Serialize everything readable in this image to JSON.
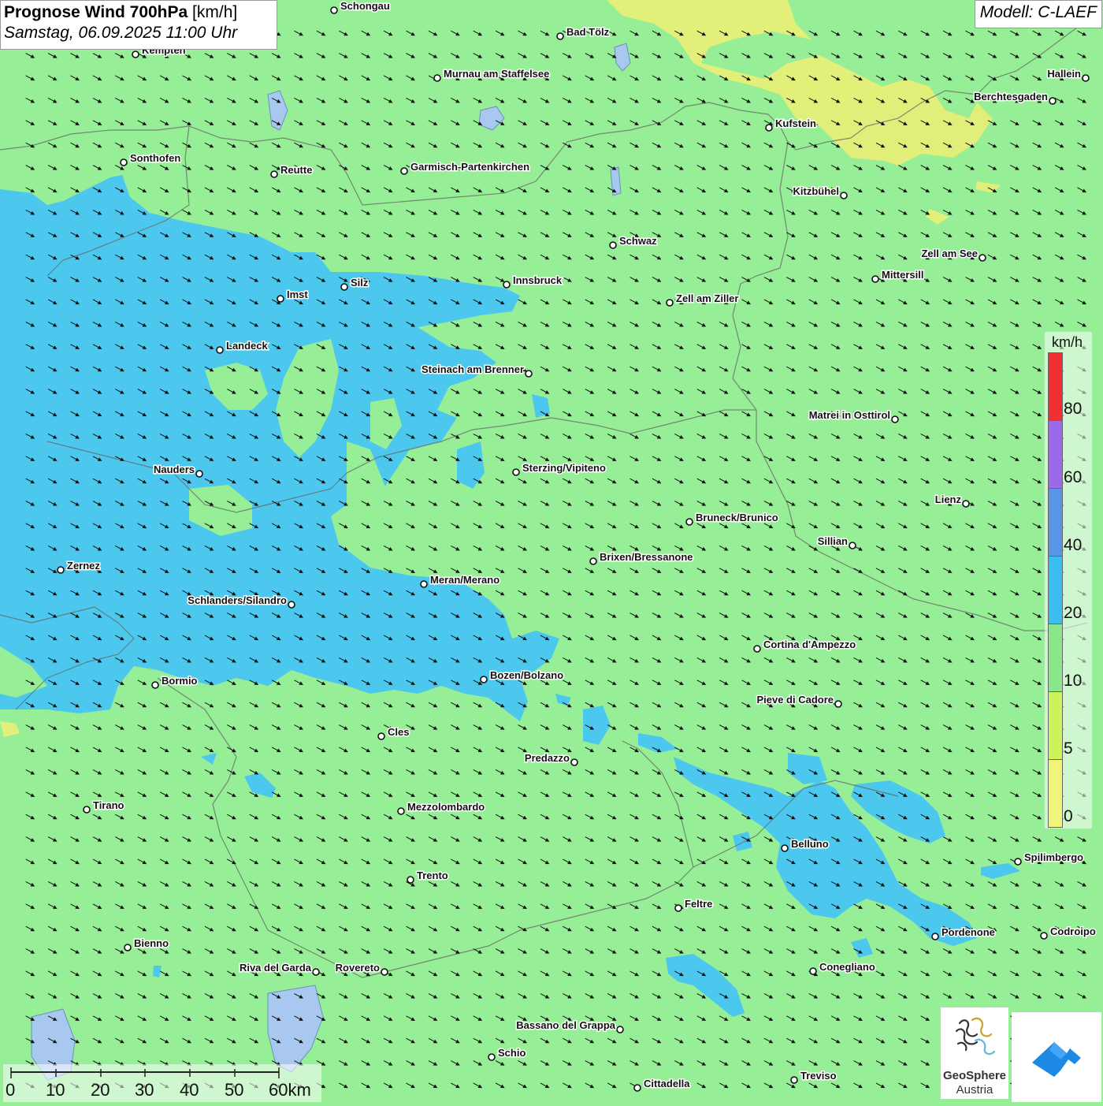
{
  "header": {
    "title_bold": "Prognose Wind 700hPa",
    "title_unit": " [km/h]",
    "datetime": "Samstag, 06.09.2025 11:00 Uhr",
    "model": "Modell: C-LAEF"
  },
  "colors": {
    "background_green": "#96ee96",
    "wind_blue": "#4cc8ee",
    "wind_yellow": "#e6ef78",
    "legend_red": "#f03030",
    "legend_purple": "#9a6ae8",
    "legend_darkblue": "#5a94e6",
    "legend_lightblue": "#3cbdf0",
    "legend_green": "#8ae68a",
    "legend_yellowgreen": "#cdf25a",
    "legend_yellow": "#f0f57a"
  },
  "legend": {
    "unit": "km/h",
    "labels": [
      "80",
      "60",
      "40",
      "20",
      "10",
      "5",
      "0"
    ]
  },
  "scale_bar": {
    "labels": [
      "0",
      "10",
      "20",
      "30",
      "40",
      "50",
      "60km"
    ]
  },
  "cities": [
    {
      "name": "Schongau"
    },
    {
      "name": "Bad Tölz"
    },
    {
      "name": "Kempten"
    },
    {
      "name": "Murnau am Staffelsee"
    },
    {
      "name": "Hallein"
    },
    {
      "name": "Berchtesgaden"
    },
    {
      "name": "Kufstein"
    },
    {
      "name": "Sonthofen"
    },
    {
      "name": "Reutte"
    },
    {
      "name": "Garmisch-Partenkirchen"
    },
    {
      "name": "Kitzbühel"
    },
    {
      "name": "Schwaz"
    },
    {
      "name": "Zell am See"
    },
    {
      "name": "Mittersill"
    },
    {
      "name": "Innsbruck"
    },
    {
      "name": "Silz"
    },
    {
      "name": "Imst"
    },
    {
      "name": "Zell am Ziller"
    },
    {
      "name": "Landeck"
    },
    {
      "name": "Steinach am Brenner"
    },
    {
      "name": "Matrei in Osttirol"
    },
    {
      "name": "Nauders"
    },
    {
      "name": "Sterzing/Vipiteno"
    },
    {
      "name": "Lienz"
    },
    {
      "name": "Bruneck/Brunico"
    },
    {
      "name": "Sillian"
    },
    {
      "name": "Zernez"
    },
    {
      "name": "Brixen/Bressanone"
    },
    {
      "name": "Meran/Merano"
    },
    {
      "name": "Schlanders/Silandro"
    },
    {
      "name": "Cortina d'Ampezzo"
    },
    {
      "name": "Bozen/Bolzano"
    },
    {
      "name": "Bormio"
    },
    {
      "name": "Pieve di Cadore"
    },
    {
      "name": "Cles"
    },
    {
      "name": "Predazzo"
    },
    {
      "name": "Tirano"
    },
    {
      "name": "Mezzolombardo"
    },
    {
      "name": "Belluno"
    },
    {
      "name": "Spilimbergo"
    },
    {
      "name": "Trento"
    },
    {
      "name": "Feltre"
    },
    {
      "name": "Pordenone"
    },
    {
      "name": "Codroipo"
    },
    {
      "name": "Bienno"
    },
    {
      "name": "Riva del Garda"
    },
    {
      "name": "Rovereto"
    },
    {
      "name": "Conegliano"
    },
    {
      "name": "Bassano del Grappa"
    },
    {
      "name": "Schio"
    },
    {
      "name": "Treviso"
    },
    {
      "name": "Cittadella"
    }
  ],
  "logos": {
    "geosphere_line1": "GeoSphere",
    "geosphere_line2": "Austria"
  }
}
